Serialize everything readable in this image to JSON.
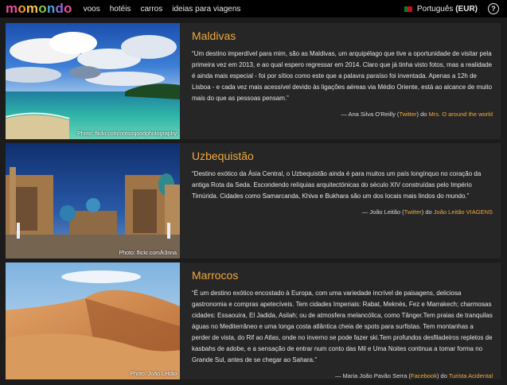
{
  "brand": {
    "letters": [
      "m",
      "o",
      "m",
      "o",
      "n",
      "d",
      "o"
    ],
    "colors": [
      "#ec4d9a",
      "#f0942f",
      "#f4c54c",
      "#8bc34a",
      "#4aa6d9",
      "#8e6bd2",
      "#ec4d9a"
    ]
  },
  "nav": {
    "items": [
      "voos",
      "hotéis",
      "carros",
      "ideias para viagens"
    ]
  },
  "language": {
    "label": "Português",
    "currency": "(EUR)"
  },
  "help_icon": "?",
  "cards": [
    {
      "title": "Maldivas",
      "quote": "“Um destino imperdível para mim, são as Maldivas, um arquipélago que tive a oportunidade de visitar pela primeira vez em 2013, e ao qual espero regressar em 2014. Claro que já tinha visto fotos, mas a realidade é ainda mais especial - foi por sítios como este que a palavra paraíso foi inventada. Apenas a 12h de Lisboa - e cada vez mais acessível devido às ligações aéreas via Médio Oriente, está ao alcance de muito mais do que as pessoas pensam.”",
      "author": "— Ana Silva O'Reilly (",
      "social": "Twitter",
      "connector": ") do ",
      "blog": "Mrs. O around the world",
      "credit_prefix": "Photo: ",
      "credit_link": "flickr.com/notsogoodphotography"
    },
    {
      "title": "Uzbequistão",
      "quote": "“Destino exótico da Ásia Central, o Uzbequistão ainda é para muitos um país longínquo no coração da antiga Rota da Seda. Escondendo relíquias arquitectónicas do século XIV construídas pelo Império Timúrida. Cidades como Samarcanda, Khiva e Bukhara são um dos locais mais lindos do mundo.”",
      "author": "— João Leitão (",
      "social": "Twitter",
      "connector": ") do ",
      "blog": "João Leitão VIAGENS",
      "credit_prefix": "Photo: ",
      "credit_link": "flickr.com/k3nna"
    },
    {
      "title": "Marrocos",
      "quote": "“É um destino exótico encostado à Europa, com uma variedade incrível de paisagens, deliciosa gastronomia e compras apetecíveis. Tem cidades Imperiais: Rabat, Meknès, Fez e Marrakech; charmosas cidades: Essaouira, El Jadida, Asilah; ou de atmosfera melancólica, como Tânger.Tem praias de tranquilas águas no Mediterrâneo e uma longa costa atlântica cheia de spots para surfistas. Tem montanhas a perder de vista, do Rif ao Atlas, onde no inverno se pode fazer ski.Tem profundos desfiladeiros repletos de kasbahs de adobe, e a sensação de entrar num conto das Mil e Uma Noites continua a tomar forma no Grande Sul, antes de se chegar ao Sahara.”",
      "author": "— Maria João Pavão Serra (",
      "social": "Facebook",
      "connector": ") do ",
      "blog": "Turista Acidental",
      "credit_prefix": "Photo: ",
      "credit_link": "João Leitão"
    }
  ]
}
